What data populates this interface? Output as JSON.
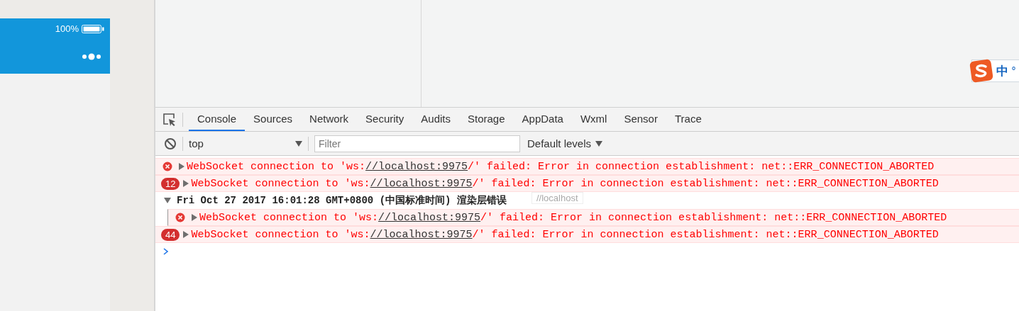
{
  "phone": {
    "battery_text": "100%"
  },
  "ime": {
    "label": "中",
    "mark": "°"
  },
  "devtools": {
    "tabs": [
      {
        "label": "Console",
        "selected": true
      },
      {
        "label": "Sources",
        "selected": false
      },
      {
        "label": "Network",
        "selected": false
      },
      {
        "label": "Security",
        "selected": false
      },
      {
        "label": "Audits",
        "selected": false
      },
      {
        "label": "Storage",
        "selected": false
      },
      {
        "label": "AppData",
        "selected": false
      },
      {
        "label": "Wxml",
        "selected": false
      },
      {
        "label": "Sensor",
        "selected": false
      },
      {
        "label": "Trace",
        "selected": false
      }
    ],
    "context": "top",
    "filter": {
      "placeholder": "Filter"
    },
    "levels": "Default levels"
  },
  "console": {
    "entries": [
      {
        "kind": "message",
        "text_before": "WebSocket connection to 'ws:",
        "link": "//localhost:9975",
        "text_after": "/' failed: Error in connection establishment: net::ERR_CONNECTION_ABORTED"
      },
      {
        "kind": "message",
        "count": "12",
        "text_before": "WebSocket connection to 'ws:",
        "link": "//localhost:9975",
        "text_after": "/' failed: Error in connection establishment: net::ERR_CONNECTION_ABORTED"
      },
      {
        "kind": "group",
        "expanded": true,
        "title": "Fri Oct 27 2017 16:01:28 GMT+0800 (中国标准时间) 渲染层错误",
        "children": [
          {
            "kind": "message",
            "text_before": "WebSocket connection to 'ws:",
            "link": "//localhost:9975",
            "text_after": "/' failed: Error in connection establishment: net::ERR_CONNECTION_ABORTED"
          }
        ]
      },
      {
        "kind": "message",
        "count": "44",
        "text_before": "WebSocket connection to 'ws:",
        "link": "//localhost:9975",
        "text_after": "/' failed: Error in connection establishment: net::ERR_CONNECTION_ABORTED"
      }
    ],
    "tooltip": "//localhost"
  }
}
